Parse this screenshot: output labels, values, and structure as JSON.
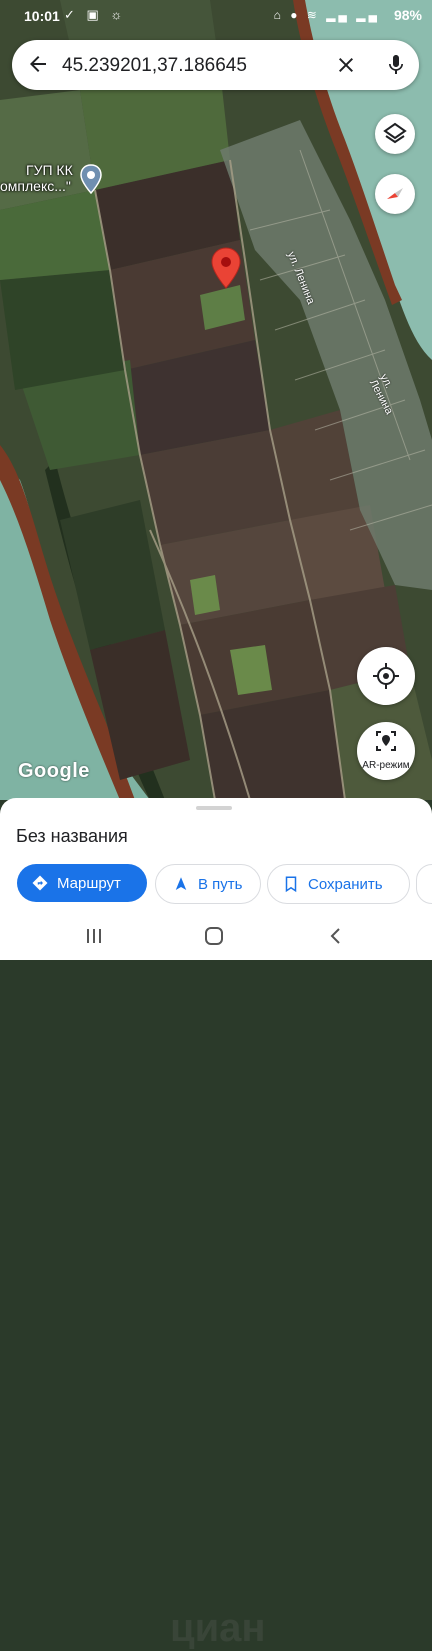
{
  "status_bar": {
    "time": "10:01",
    "battery": "98%"
  },
  "search": {
    "query": "45.239201,37.186645"
  },
  "map": {
    "place_label_line1": "ГУП КК",
    "place_label_line2": "омплекс...\"",
    "street_1": "ул. Ленина",
    "street_2": "ул. Ленина",
    "attribution": "Google",
    "ar_label": "AR-режим"
  },
  "sheet": {
    "title": "Без названия",
    "actions": [
      {
        "label": "Маршрут"
      },
      {
        "label": "В путь"
      },
      {
        "label": "Сохранить"
      }
    ]
  },
  "watermark": "циан",
  "colors": {
    "accent": "#1a73e8",
    "pin": "#ea4335",
    "sea": "#7fb3a3"
  }
}
